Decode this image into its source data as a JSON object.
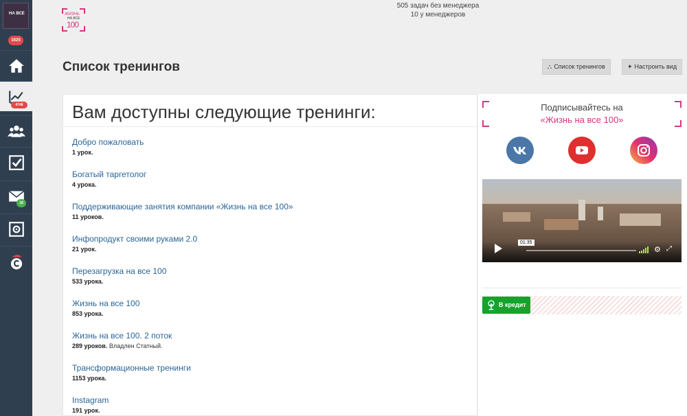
{
  "app": {
    "logo_text": "ЖИЗНЬ НА ВСЕ 100",
    "logo_line1": "ЖИЗНЬ",
    "logo_line2": "НА ВСЕ",
    "logo_line3": "100"
  },
  "sidebar": {
    "logo_text": "НА ВСЕ",
    "top_badge": "1025",
    "items": [
      {
        "name": "home",
        "badge": ""
      },
      {
        "name": "trainings",
        "badge": "4748",
        "active": true
      },
      {
        "name": "users",
        "badge": ""
      },
      {
        "name": "tasks",
        "badge": ""
      },
      {
        "name": "messages",
        "badge": "18"
      },
      {
        "name": "safe",
        "badge": ""
      },
      {
        "name": "sales",
        "badge": ""
      }
    ]
  },
  "header": {
    "tasks_line1": "505 задач без менеджера",
    "tasks_line2": "10 у менеджеров",
    "page_title": "Список тренингов",
    "btn_list": "Список тренингов",
    "btn_view": "Настроить вид"
  },
  "main": {
    "title": "Вам доступны следующие тренинги:",
    "trainings": [
      {
        "name": "Добро пожаловать",
        "lessons": "1 урок.",
        "author": ""
      },
      {
        "name": "Богатый таргетолог",
        "lessons": "4 урока.",
        "author": ""
      },
      {
        "name": "Поддерживающие занятия компании «Жизнь на все 100»",
        "lessons": "11 уроков.",
        "author": ""
      },
      {
        "name": "Инфопродукт своими руками 2.0",
        "lessons": "21 урок.",
        "author": ""
      },
      {
        "name": "Перезагрузка на все 100",
        "lessons": "533 урока.",
        "author": ""
      },
      {
        "name": "Жизнь на все 100",
        "lessons": "853 урока.",
        "author": ""
      },
      {
        "name": "Жизнь на все 100. 2 поток",
        "lessons": "289 уроков.",
        "author": "Владлен Статный."
      },
      {
        "name": "Трансформационные тренинги",
        "lessons": "1153 урока.",
        "author": ""
      },
      {
        "name": "Instagram",
        "lessons": "191 урок.",
        "author": ""
      }
    ]
  },
  "aside": {
    "subscribe_line1": "Подписывайтесь на",
    "subscribe_line2": "«Жизнь на все 100»",
    "social": [
      {
        "name": "vk",
        "color": "#4a76a8"
      },
      {
        "name": "youtube",
        "color": "#e02f2f"
      },
      {
        "name": "instagram",
        "color": "#d6249f"
      }
    ],
    "video_time": "01:35",
    "credit_label": "В кредит"
  },
  "colors": {
    "accent": "#d6357f",
    "link": "#2a6496",
    "sidebar": "#2f3f50",
    "credit": "#16a22c"
  }
}
